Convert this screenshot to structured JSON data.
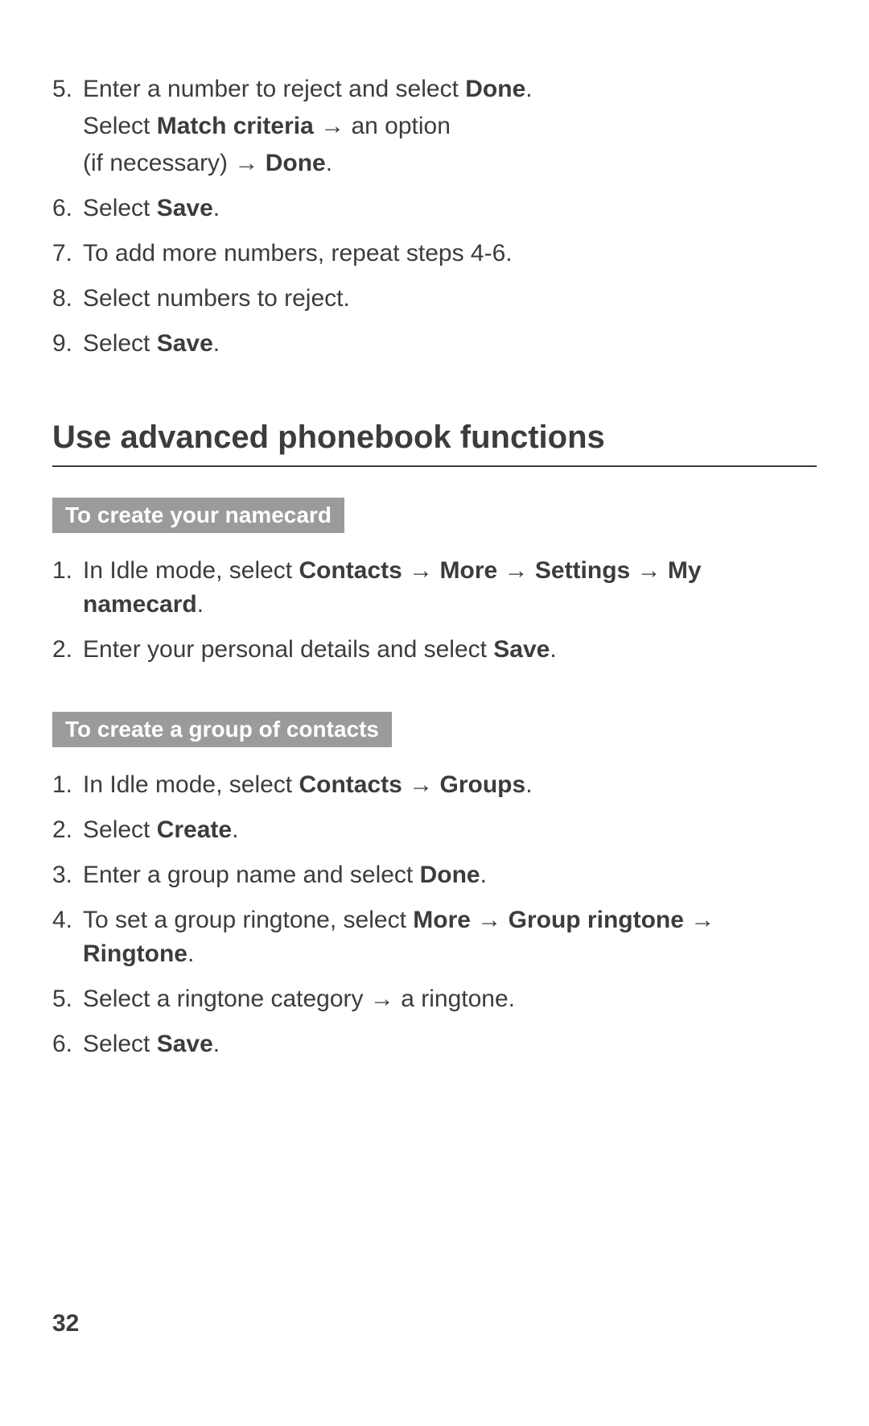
{
  "arrow": "→",
  "list1": {
    "items": [
      {
        "num": "5.",
        "segments": [
          "Enter a number to reject and select ",
          {
            "b": "Done"
          },
          "."
        ],
        "sublines": [
          {
            "segments": [
              "Select ",
              {
                "b": "Match criteria"
              },
              " → an option"
            ]
          },
          {
            "segments": [
              "(if necessary) → ",
              {
                "b": "Done"
              },
              "."
            ]
          }
        ]
      },
      {
        "num": "6.",
        "segments": [
          "Select ",
          {
            "b": "Save"
          },
          "."
        ]
      },
      {
        "num": "7.",
        "segments": [
          "To add more numbers, repeat steps 4-6."
        ]
      },
      {
        "num": "8.",
        "segments": [
          "Select numbers to reject."
        ]
      },
      {
        "num": "9.",
        "segments": [
          "Select ",
          {
            "b": "Save"
          },
          "."
        ]
      }
    ]
  },
  "section_heading": "Use advanced phonebook functions",
  "subsection1": {
    "heading": "To create your namecard",
    "items": [
      {
        "num": "1.",
        "segments": [
          "In Idle mode, select ",
          {
            "b": "Contacts"
          },
          " → ",
          {
            "b": "More"
          },
          " → ",
          {
            "b": "Settings"
          },
          " → ",
          {
            "b": "My namecard"
          },
          "."
        ]
      },
      {
        "num": "2.",
        "segments": [
          "Enter your personal details and select ",
          {
            "b": "Save"
          },
          "."
        ]
      }
    ]
  },
  "subsection2": {
    "heading": "To create a group of contacts",
    "items": [
      {
        "num": "1.",
        "segments": [
          "In Idle mode, select ",
          {
            "b": "Contacts"
          },
          " → ",
          {
            "b": "Groups"
          },
          "."
        ]
      },
      {
        "num": "2.",
        "segments": [
          "Select ",
          {
            "b": "Create"
          },
          "."
        ]
      },
      {
        "num": "3.",
        "segments": [
          "Enter a group name and select ",
          {
            "b": "Done"
          },
          "."
        ]
      },
      {
        "num": "4.",
        "segments": [
          "To set a group ringtone, select ",
          {
            "b": "More"
          },
          " → ",
          {
            "b": "Group ringtone"
          },
          " → ",
          {
            "b": "Ringtone"
          },
          "."
        ]
      },
      {
        "num": "5.",
        "segments": [
          "Select a ringtone category → a ringtone."
        ]
      },
      {
        "num": "6.",
        "segments": [
          "Select ",
          {
            "b": "Save"
          },
          "."
        ]
      }
    ]
  },
  "page_number": "32"
}
